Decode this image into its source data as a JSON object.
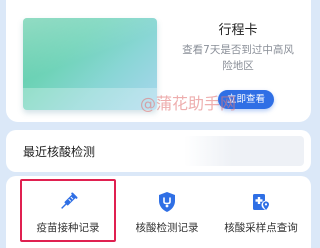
{
  "trip_card": {
    "title": "行程卡",
    "description": "查看7天是否到过中高风险地区",
    "button_label": "立即查看"
  },
  "watermark": "@蒲花助手网",
  "recent_test": {
    "title": "最近核酸检测"
  },
  "services": [
    {
      "label": "疫苗接种记录",
      "icon": "syringe-icon",
      "highlighted": true
    },
    {
      "label": "核酸检测记录",
      "icon": "shield-stethoscope-icon",
      "highlighted": false
    },
    {
      "label": "核酸采样点查询",
      "icon": "hospital-location-icon",
      "highlighted": false
    }
  ],
  "colors": {
    "accent": "#2f6fe5",
    "highlight": "#e02050",
    "background": "#dbe8f8"
  }
}
